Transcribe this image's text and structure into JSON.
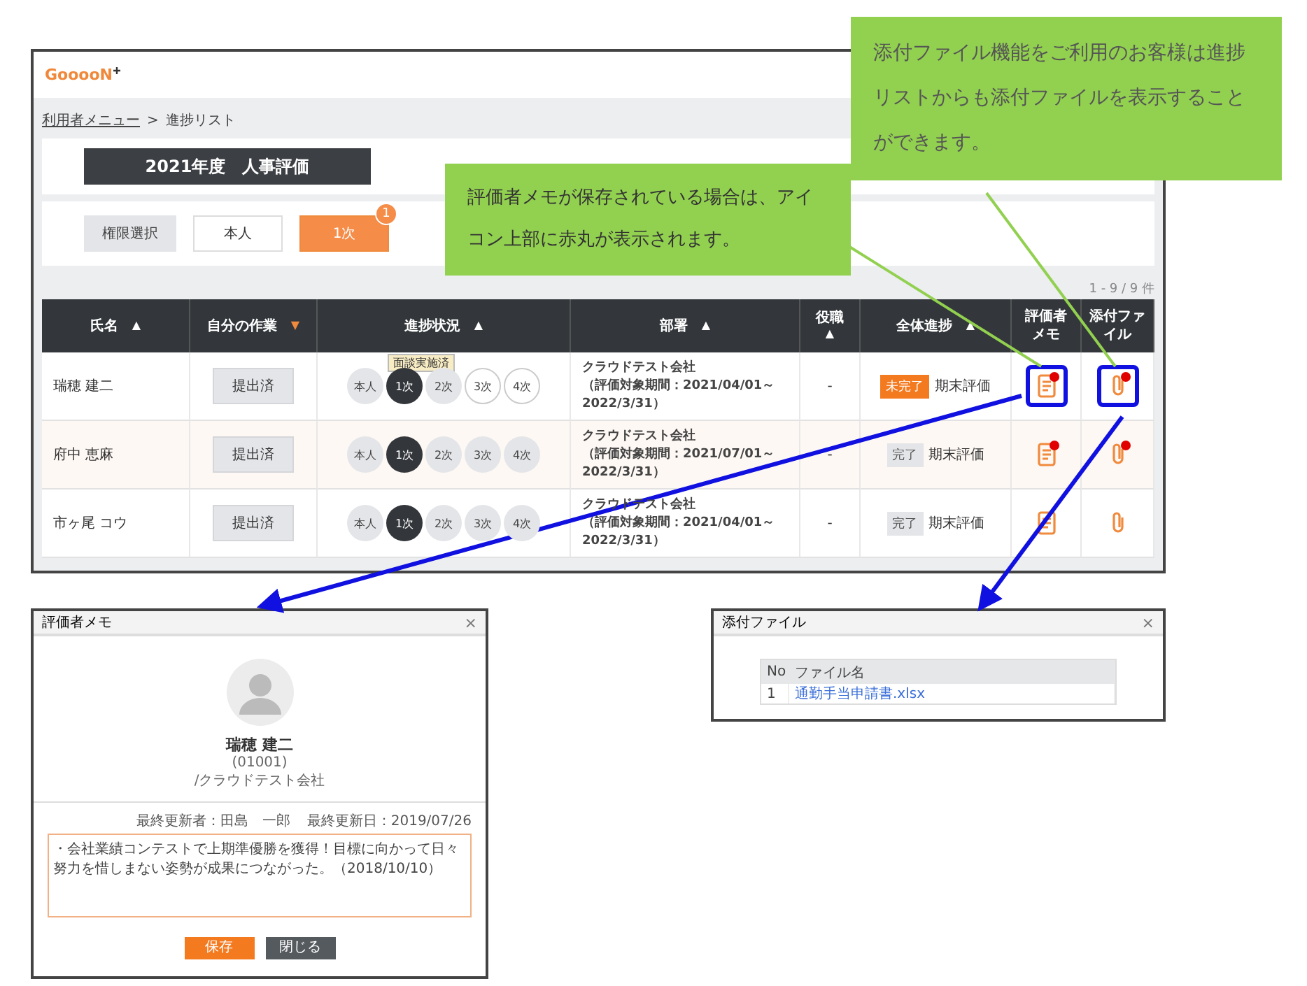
{
  "app": {
    "logo": "GooooN",
    "breadcrumb": [
      {
        "label": "利用者メニュー",
        "link": true
      },
      {
        "label": ">",
        "link": false
      },
      {
        "label": "進捗リスト",
        "link": false
      }
    ],
    "title": "2021年度　人事評価",
    "role_label": "権限選択",
    "role_tabs": [
      {
        "label": "本人",
        "selected": false
      },
      {
        "label": "1次",
        "selected": true,
        "badge": "1"
      }
    ],
    "count": "1 - 9 / 9 件",
    "columns": [
      {
        "label": "氏名",
        "sort_mark": "▲",
        "sort_active": false
      },
      {
        "label": "自分の作業",
        "sort_mark": "▼",
        "sort_active": true
      },
      {
        "label": "進捗状況",
        "sort_mark": "▲",
        "sort_active": false
      },
      {
        "label": "部署",
        "sort_mark": "▲",
        "sort_active": false
      },
      {
        "label": "役職",
        "sort_mark": "▲",
        "sort_active": false
      },
      {
        "label": "全体進捗",
        "sort_mark": "▲",
        "sort_active": false
      },
      {
        "lines": [
          "評価者",
          "メモ"
        ]
      },
      {
        "lines": [
          "添付ファ",
          "イル"
        ]
      }
    ],
    "rows": [
      {
        "name": "瑞穂 建二",
        "task": "提出済",
        "steps": [
          {
            "label": "本人",
            "kind": "done"
          },
          {
            "label": "1次",
            "kind": "current"
          },
          {
            "label": "2次",
            "kind": "done"
          },
          {
            "label": "3次",
            "kind": "open"
          },
          {
            "label": "4次",
            "kind": "open"
          }
        ],
        "tooltip": "面談実施済",
        "dept": "クラウドテスト会社",
        "period": "（評価対象期間：2021/04/01～2022/3/31）",
        "position": "-",
        "complete": false,
        "status": "未完了",
        "phase": "期末評価",
        "memo_dot": true,
        "file_dot": true,
        "highlighted": true
      },
      {
        "name": "府中 恵麻",
        "task": "提出済",
        "steps": [
          {
            "label": "本人",
            "kind": "done"
          },
          {
            "label": "1次",
            "kind": "current"
          },
          {
            "label": "2次",
            "kind": "done"
          },
          {
            "label": "3次",
            "kind": "done"
          },
          {
            "label": "4次",
            "kind": "done"
          }
        ],
        "dept": "クラウドテスト会社",
        "period": "（評価対象期間：2021/07/01～2022/3/31）",
        "position": "-",
        "complete": true,
        "status": "完了",
        "phase": "期末評価",
        "memo_dot": true,
        "file_dot": true,
        "highlighted": false
      },
      {
        "name": "市ヶ尾 コウ",
        "task": "提出済",
        "steps": [
          {
            "label": "本人",
            "kind": "done"
          },
          {
            "label": "1次",
            "kind": "current"
          },
          {
            "label": "2次",
            "kind": "done"
          },
          {
            "label": "3次",
            "kind": "done"
          },
          {
            "label": "4次",
            "kind": "done"
          }
        ],
        "dept": "クラウドテスト会社",
        "period": "（評価対象期間：2021/04/01～2022/3/31）",
        "position": "-",
        "complete": true,
        "status": "完了",
        "phase": "期末評価",
        "memo_dot": false,
        "file_dot": false,
        "highlighted": false
      }
    ]
  },
  "callouts": [
    {
      "text": "評価者メモが保存されている場合は、アイコン上部に赤丸が表示されます。"
    },
    {
      "text": "添付ファイル機能をご利用のお客様は進捗リストからも添付ファイルを表示することができます。"
    }
  ],
  "memo_dialog": {
    "title": "評価者メモ",
    "close": "×",
    "name": "瑞穂 建二",
    "employee_id": "(01001)",
    "company": "/クラウドテスト会社",
    "updated_by": "最終更新者：田島　一郎",
    "updated_on": "最終更新日：2019/07/26",
    "memo": "・会社業績コンテストで上期準優勝を獲得！目標に向かって日々努力を惜しまない姿勢が成果につながった。（2018/10/10）",
    "save": "保存",
    "cancel": "閉じる"
  },
  "file_dialog": {
    "title": "添付ファイル",
    "close": "×",
    "columns": [
      "No",
      "ファイル名"
    ],
    "rows": [
      {
        "no": "1",
        "file": "通勤手当申請書.xlsx"
      }
    ]
  }
}
